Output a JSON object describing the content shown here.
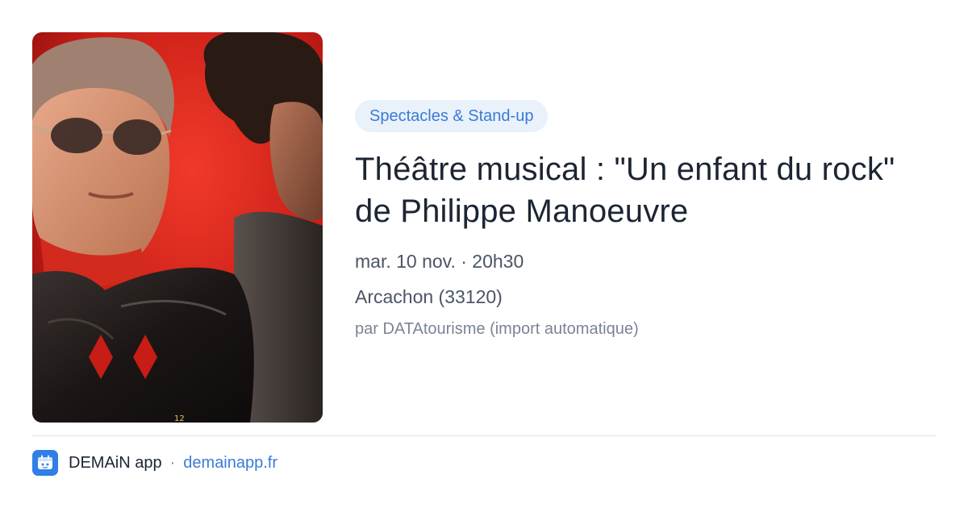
{
  "event": {
    "category": "Spectacles & Stand-up",
    "title": "Théâtre musical : \"Un enfant du rock\" de Philippe Manoeuvre",
    "datetime": "mar. 10 nov. · 20h30",
    "location": "Arcachon (33120)",
    "source": "par DATAtourisme (import automatique)"
  },
  "footer": {
    "app_name": "DEMAiN app",
    "separator": "·",
    "domain": "demainapp.fr"
  },
  "colors": {
    "accent": "#3a7bd5",
    "badge_bg": "#e9f1fb",
    "title": "#1c2533",
    "meta": "#4a5565",
    "poster_red": "#d8241c"
  },
  "icons": {
    "app_logo": "demain-app-logo-icon"
  }
}
